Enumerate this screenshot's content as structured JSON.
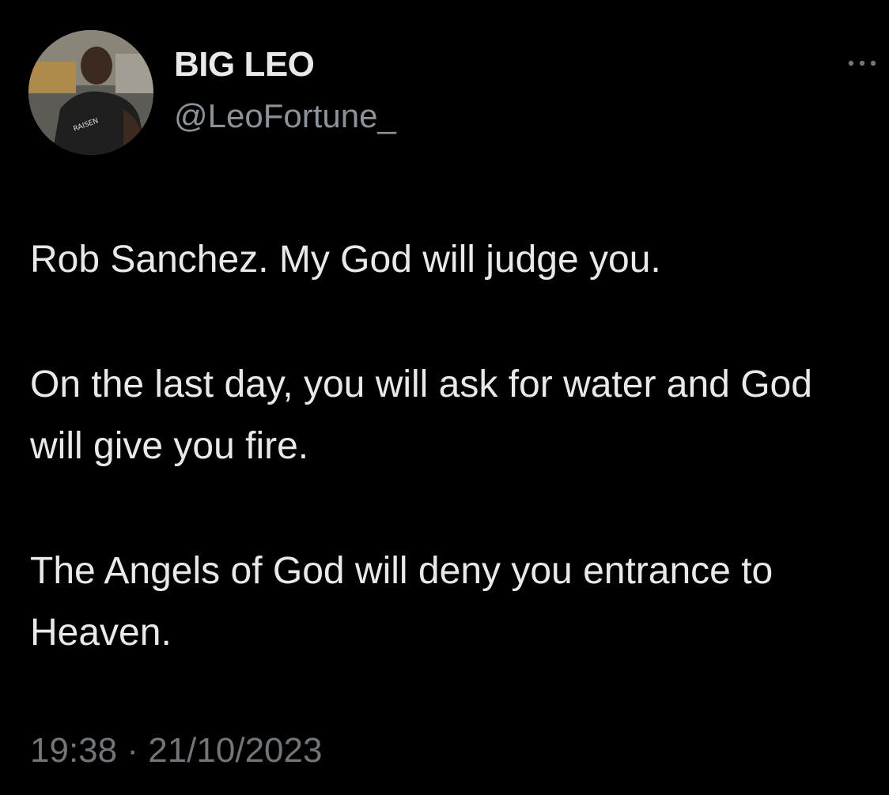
{
  "author": {
    "display_name": "BIG LEO",
    "handle": "@LeoFortune_",
    "avatar_icon": "profile-photo"
  },
  "menu": {
    "icon": "more-horizontal-icon"
  },
  "tweet": {
    "paragraphs": [
      "Rob Sanchez. My God will judge you.",
      "On the last day, you will ask for water and God will give you fire.",
      "The Angels of God will deny you entrance to Heaven."
    ]
  },
  "timestamp": {
    "time": "19:38",
    "separator": "·",
    "date": "21/10/2023"
  },
  "colors": {
    "background": "#000000",
    "primary_text": "#e7e9ea",
    "secondary_text": "#71767b"
  }
}
